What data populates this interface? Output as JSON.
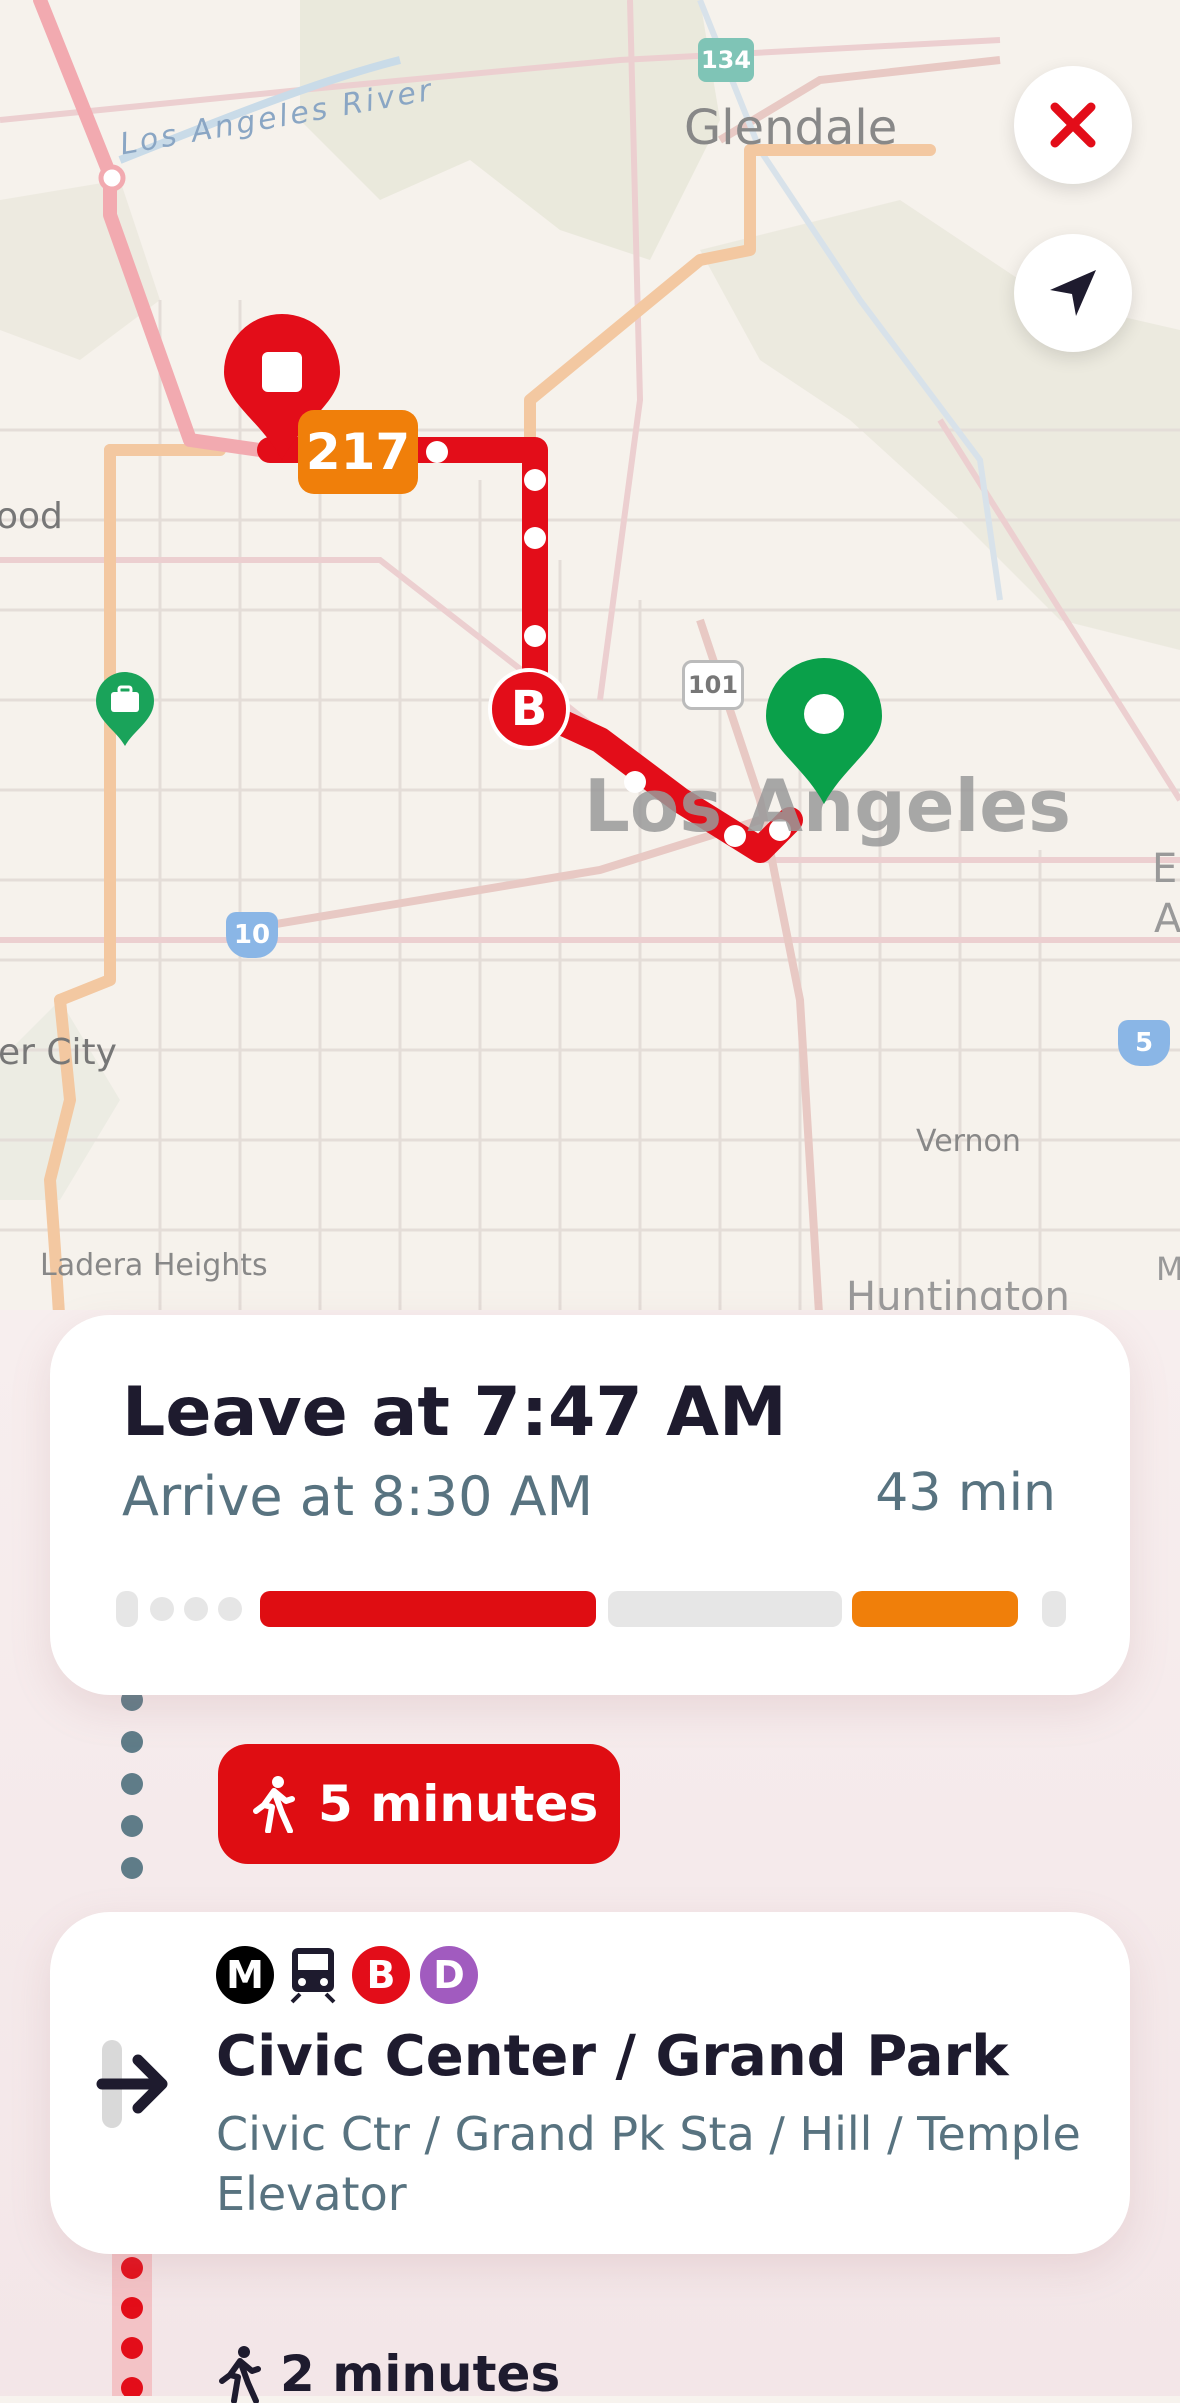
{
  "map": {
    "labels": {
      "river": "Los Angeles River",
      "glendale": "Glendale",
      "hollywood_partial": "ood",
      "los_angeles": "Los Angeles",
      "culver_city_partial": "er City",
      "vernon": "Vernon",
      "ladera_heights": "Ladera Heights",
      "huntington": "Huntington",
      "edge_e": "E",
      "edge_a": "A",
      "edge_m": "M"
    },
    "shields": {
      "sr134": "134",
      "us101": "101",
      "i10": "10",
      "i5": "5"
    },
    "route_badges": {
      "bus": "217",
      "rail_line": "B"
    },
    "close_button_icon": "close-icon",
    "locate_button_icon": "location-arrow-icon",
    "colors": {
      "rail": "#e30d19",
      "bus": "#f07f0a",
      "destination": "#0aa04a",
      "origin": "#e30d19"
    }
  },
  "summary": {
    "leave": "Leave at 7:47 AM",
    "arrive": "Arrive at 8:30 AM",
    "duration": "43 min"
  },
  "walk_step": {
    "icon": "walking-icon",
    "label": "5 minutes"
  },
  "stop": {
    "badges": [
      "M",
      "B",
      "D"
    ],
    "name": "Civic Center / Grand Park",
    "subtitle": "Civic Ctr / Grand Pk Sta / Hill / Temple Elevator"
  },
  "walk_step_2": {
    "label": "2 minutes"
  }
}
